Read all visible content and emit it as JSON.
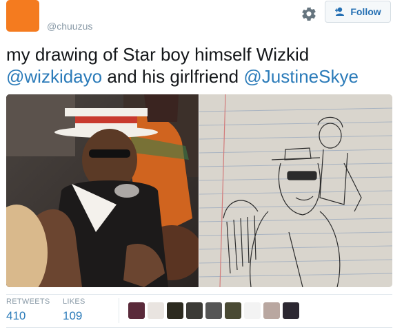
{
  "header": {
    "handle": "@chuuzus",
    "avatar_color": "#f47b1f",
    "follow_label": "Follow",
    "gear_icon": "gear-icon",
    "follow_icon": "add-user-icon"
  },
  "tweet": {
    "segments": [
      {
        "type": "text",
        "value": "my drawing of Star boy himself Wizkid "
      },
      {
        "type": "mention",
        "value": "@wizkidayo"
      },
      {
        "type": "text",
        "value": " and his girlfriend "
      },
      {
        "type": "mention",
        "value": "@JustineSkye"
      }
    ]
  },
  "media": {
    "photos": [
      {
        "name": "photo-of-wizkid"
      },
      {
        "name": "drawing-on-lined-paper"
      }
    ]
  },
  "stats": {
    "retweets_label": "RETWEETS",
    "retweets_value": "410",
    "likes_label": "LIKES",
    "likes_value": "109"
  },
  "likers": {
    "colors": [
      "#5a2a3a",
      "#e9e4e0",
      "#2c2a1f",
      "#3b3a36",
      "#555555",
      "#4a4a34",
      "#f3f3f3",
      "#b9a7a0",
      "#2c2832"
    ]
  },
  "colors": {
    "link": "#2b7bb9",
    "muted": "#8899a6",
    "text": "#14171a"
  }
}
